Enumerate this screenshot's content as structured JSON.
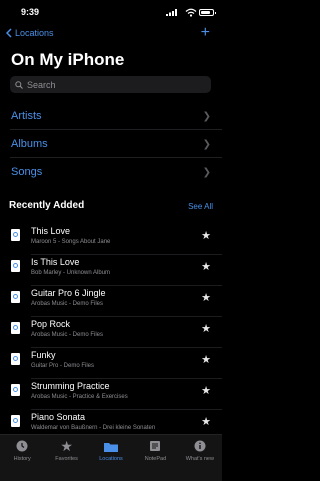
{
  "status": {
    "time": "9:39"
  },
  "nav": {
    "back_label": "Locations",
    "add": "+"
  },
  "page": {
    "title": "On My iPhone"
  },
  "search": {
    "placeholder": "Search"
  },
  "nav_rows": [
    {
      "label": "Artists"
    },
    {
      "label": "Albums"
    },
    {
      "label": "Songs"
    }
  ],
  "recent": {
    "heading": "Recently Added",
    "see_all": "See All",
    "songs": [
      {
        "title": "This Love",
        "subtitle": "Maroon 5 - Songs About Jane"
      },
      {
        "title": "Is This Love",
        "subtitle": "Bob Marley - Unknown Album"
      },
      {
        "title": "Guitar Pro 6 Jingle",
        "subtitle": "Arobas Music - Demo Files"
      },
      {
        "title": "Pop Rock",
        "subtitle": "Arobas Music - Demo Files"
      },
      {
        "title": "Funky",
        "subtitle": "Guitar Pro - Demo Files"
      },
      {
        "title": "Strumming Practice",
        "subtitle": "Arobas Music - Practice & Exercises"
      },
      {
        "title": "Piano Sonata",
        "subtitle": "Waldemar von Baußnern - Drei kleine Sonaten"
      }
    ]
  },
  "tabs": [
    {
      "label": "History",
      "icon": "clock-icon"
    },
    {
      "label": "Favorites",
      "icon": "star-icon"
    },
    {
      "label": "Locations",
      "icon": "folder-icon"
    },
    {
      "label": "NotePad",
      "icon": "notepad-icon"
    },
    {
      "label": "What's new",
      "icon": "info-icon"
    }
  ],
  "colors": {
    "accent": "#4a90e8",
    "background": "#000000"
  }
}
